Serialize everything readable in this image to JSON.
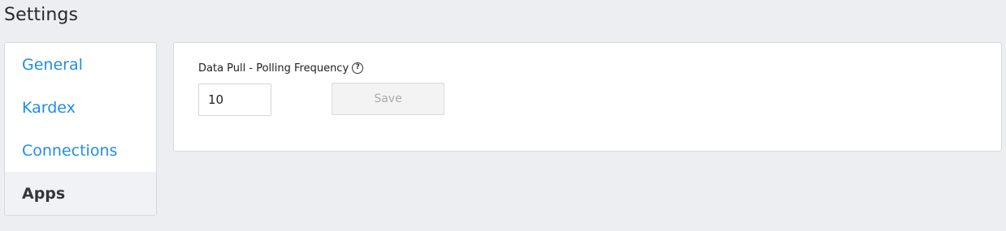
{
  "page": {
    "title": "Settings"
  },
  "sidebar": {
    "items": [
      {
        "label": "General",
        "active": false
      },
      {
        "label": "Kardex",
        "active": false
      },
      {
        "label": "Connections",
        "active": false
      },
      {
        "label": "Apps",
        "active": true
      }
    ]
  },
  "apps_panel": {
    "polling_frequency": {
      "label": "Data Pull - Polling Frequency",
      "help_icon": "question-circle-icon",
      "value": "10"
    },
    "save_label": "Save",
    "save_disabled": true
  },
  "colors": {
    "background": "#eceef2",
    "link": "#1f8de6",
    "active_item_bg": "#f1f2f5"
  }
}
